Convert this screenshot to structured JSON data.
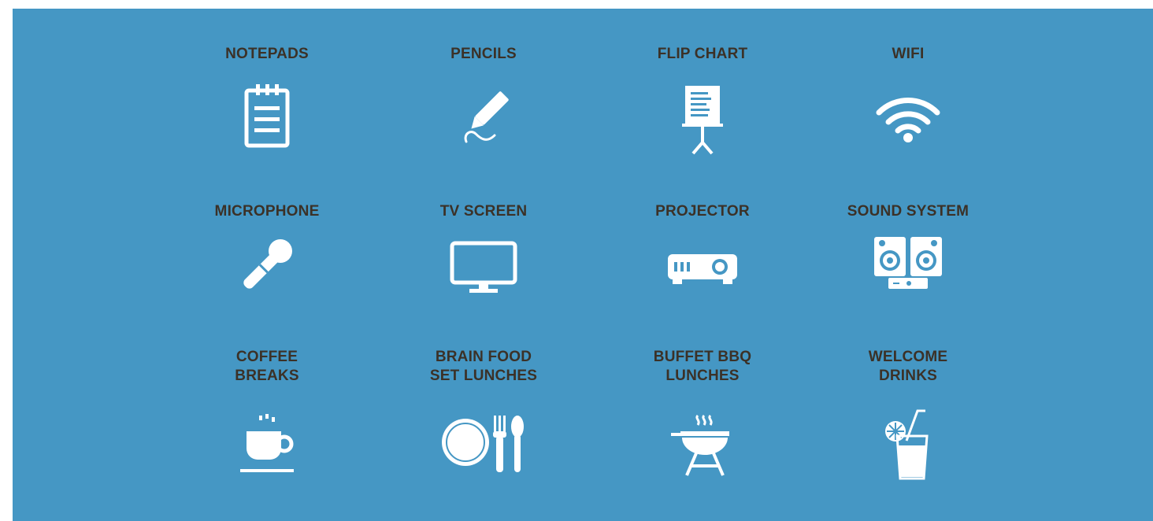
{
  "colors": {
    "panel_background": "#4597c4",
    "label_text": "#3b3127",
    "icon": "#ffffff"
  },
  "amenities": [
    {
      "label": "NOTEPADS",
      "icon": "notepad-icon"
    },
    {
      "label": "PENCILS",
      "icon": "pencil-icon"
    },
    {
      "label": "FLIP CHART",
      "icon": "flip-chart-icon"
    },
    {
      "label": "WIFI",
      "icon": "wifi-icon"
    },
    {
      "label": "MICROPHONE",
      "icon": "microphone-icon"
    },
    {
      "label": "TV SCREEN",
      "icon": "tv-screen-icon"
    },
    {
      "label": "PROJECTOR",
      "icon": "projector-icon"
    },
    {
      "label": "SOUND SYSTEM",
      "icon": "sound-system-icon"
    },
    {
      "label": "COFFEE\nBREAKS",
      "icon": "coffee-cup-icon"
    },
    {
      "label": "BRAIN FOOD\nSET LUNCHES",
      "icon": "plate-cutlery-icon"
    },
    {
      "label": "BUFFET BBQ\nLUNCHES",
      "icon": "bbq-grill-icon"
    },
    {
      "label": "WELCOME\nDRINKS",
      "icon": "drink-glass-icon"
    }
  ]
}
